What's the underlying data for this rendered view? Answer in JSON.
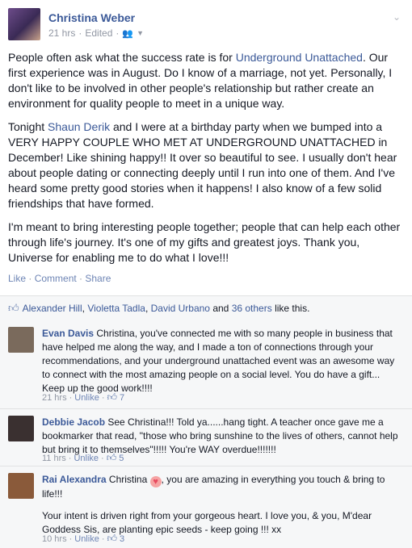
{
  "post": {
    "author": "Christina Weber",
    "time": "21 hrs",
    "edited": "Edited",
    "dot": "·",
    "paragraphs": [
      {
        "before": "People often ask what the success rate is for ",
        "link": "Underground Unattached",
        "after": ". Our first experience was in August. Do I know of a marriage, not yet. Personally, I don't like to be involved in other people's relationship but rather create an environment for quality people to meet in a unique way."
      },
      {
        "before": "Tonight ",
        "link": "Shaun Derik",
        "after": " and I were at a birthday party when we bumped into a VERY HAPPY COUPLE WHO MET AT UNDERGROUND UNATTACHED in December! Like shining happy!! It over so beautiful to see. I usually don't hear about people dating or connecting deeply until I run into one of them. And I've heard some pretty good stories when it happens! I also know of a few solid friendships that have formed."
      },
      {
        "before": "I'm meant to bring interesting people together; people that can help each other through life's journey. It's one of my gifts and greatest joys. Thank you, Universe for enabling me to do what I love!!!",
        "link": "",
        "after": ""
      }
    ],
    "actions": {
      "like": "Like",
      "comment": "Comment",
      "share": "Share",
      "sep": " · "
    }
  },
  "likes": {
    "names": [
      "Alexander Hill",
      "Violetta Tadla",
      "David Urbano"
    ],
    "comma": ", ",
    "and": " and ",
    "others": "36 others",
    "suffix": " like this."
  },
  "comments": [
    {
      "name": "Evan Davis",
      "text": " Christina, you've connected me with so many people in business that have helped me along the way, and I made a ton of connections through your recommendations, and your underground unattached event was an awesome way to connect with the most amazing people on a social level. You do have a gift... Keep up the good work!!!!",
      "time": "21 hrs",
      "unlike": "Unlike",
      "likes": "7",
      "avatar_color": "#7a6a5c"
    },
    {
      "name": "Debbie Jacob",
      "text": " See Christina!!! Told ya......hang tight. A teacher once gave me a bookmarker that read, \"those who bring sunshine to the lives of others, cannot help but bring it to themselves\"!!!!! You're WAY overdue!!!!!!!",
      "time": "11 hrs",
      "unlike": "Unlike",
      "likes": "5",
      "avatar_color": "#3a3030"
    },
    {
      "name": "Rai Alexandra",
      "text_a": " Christina ",
      "text_b": ", you are amazing in everything you touch & bring to life!!!",
      "text2": "Your intent is driven right from your gorgeous heart. I love you, & you, M'dear Goddess Sis, are planting epic seeds - keep going !!! xx",
      "time": "10 hrs",
      "unlike": "Unlike",
      "likes": "3",
      "avatar_color": "#8a5a3a"
    }
  ],
  "icons": {
    "audience": "friends-icon",
    "chevron": "chevron-down-icon",
    "like": "thumbs-up-icon",
    "heart": "heart-emoji"
  }
}
